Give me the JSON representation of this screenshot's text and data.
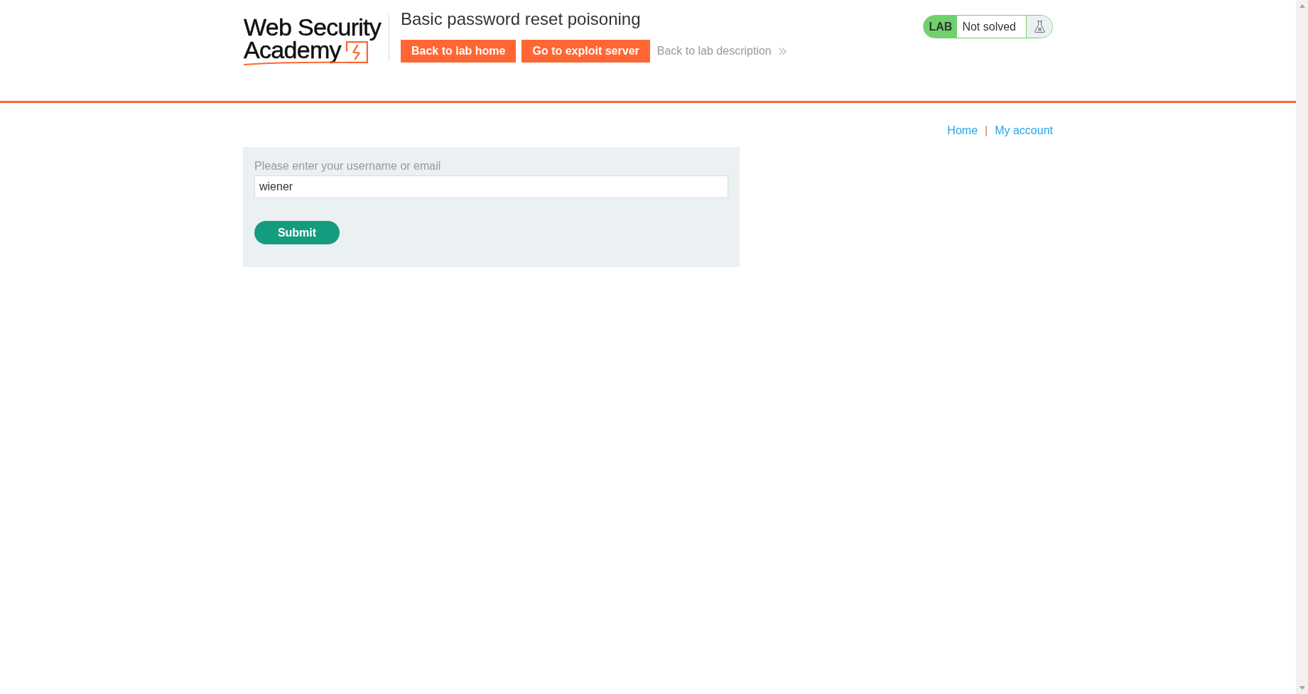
{
  "header": {
    "logo": {
      "lines": [
        "Web Security",
        "Academy"
      ]
    },
    "title": "Basic password reset poisoning",
    "buttons": [
      "Back to lab home",
      "Go to exploit server"
    ],
    "description_link": "Back to lab description",
    "lab_status": {
      "label": "LAB",
      "status": "Not solved"
    }
  },
  "nav": {
    "links": [
      "Home",
      "My account"
    ],
    "separator": "|"
  },
  "form": {
    "label": "Please enter your username or email",
    "value": "wiener",
    "submit": "Submit"
  }
}
